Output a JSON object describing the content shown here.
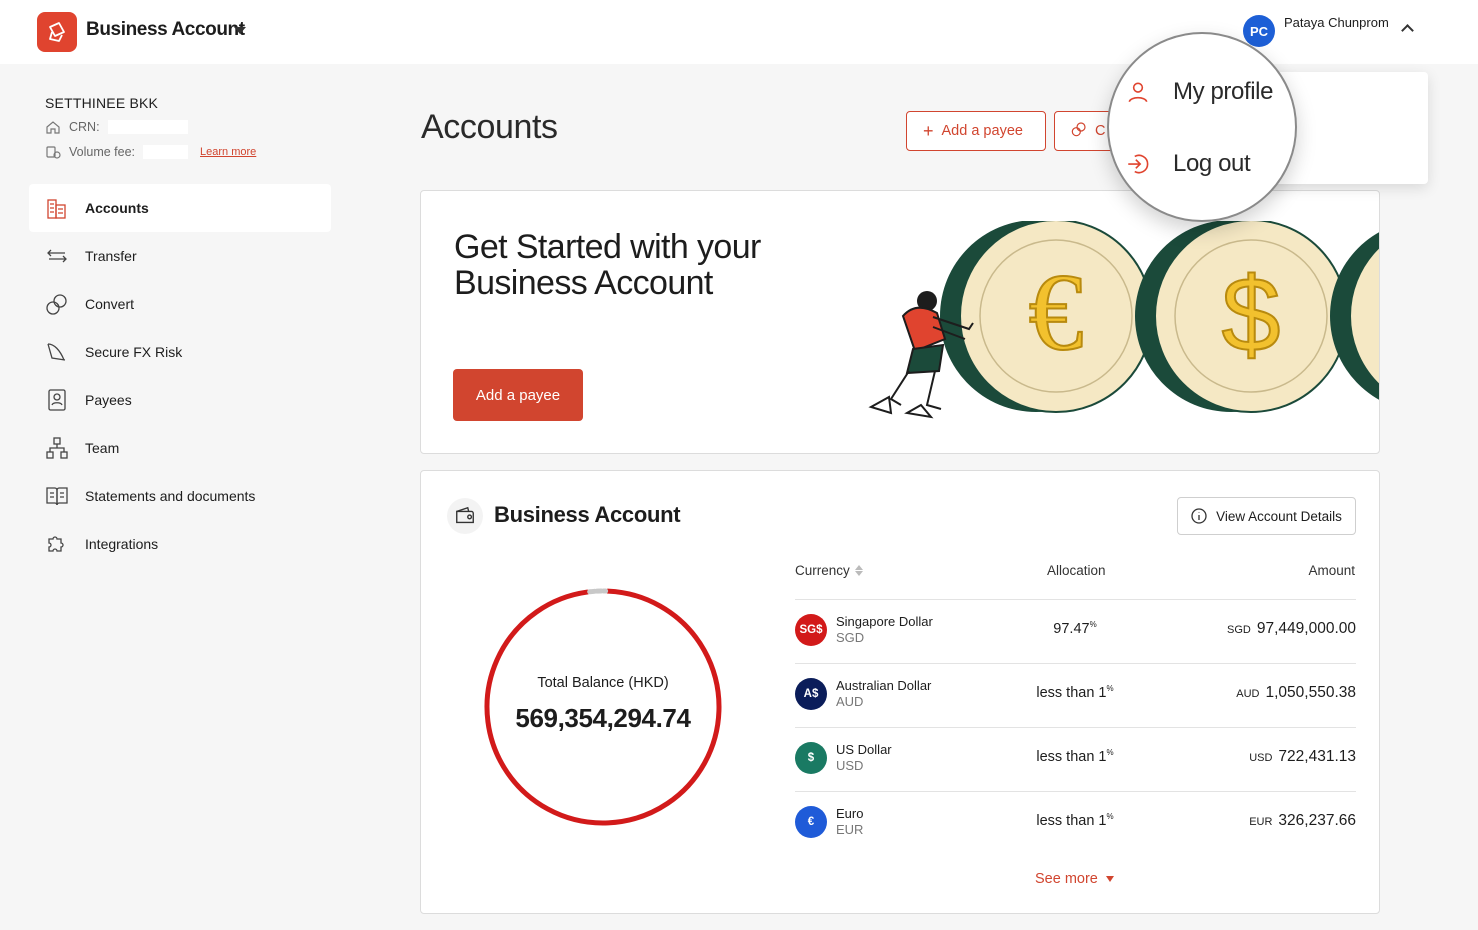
{
  "header": {
    "brand": "Business Account",
    "user_initials": "PC",
    "user_name": "Pataya Chunprom"
  },
  "sidebar": {
    "org_name": "SETTHINEE BKK",
    "crn_label": "CRN:",
    "volume_fee_label": "Volume fee:",
    "learn_more": "Learn more",
    "items": [
      {
        "label": "Accounts",
        "icon": "building-icon",
        "active": true
      },
      {
        "label": "Transfer",
        "icon": "transfer-arrows-icon"
      },
      {
        "label": "Convert",
        "icon": "convert-currency-icon"
      },
      {
        "label": "Secure FX Risk",
        "icon": "shield-fx-icon"
      },
      {
        "label": "Payees",
        "icon": "payee-contact-icon"
      },
      {
        "label": "Team",
        "icon": "team-hierarchy-icon"
      },
      {
        "label": "Statements and documents",
        "icon": "document-book-icon"
      },
      {
        "label": "Integrations",
        "icon": "puzzle-icon"
      }
    ]
  },
  "main": {
    "title": "Accounts",
    "add_payee_button": "Add a payee",
    "convert_button_partial": "C",
    "promo": {
      "title": "Get Started with your Business Account",
      "button": "Add a payee"
    },
    "business_account": {
      "title": "Business Account",
      "view_details_button": "View Account Details",
      "total_balance_label": "Total Balance (HKD)",
      "total_balance_value": "569,354,294.74",
      "columns": {
        "currency": "Currency",
        "allocation": "Allocation",
        "amount": "Amount"
      },
      "rows": [
        {
          "badge": "SG$",
          "badge_color": "#d21a1a",
          "name": "Singapore Dollar",
          "code": "SGD",
          "allocation": "97.47",
          "allocation_suffix": "%",
          "amount_code": "SGD",
          "amount": "97,449,000.00"
        },
        {
          "badge": "A$",
          "badge_color": "#0b1d5a",
          "name": "Australian Dollar",
          "code": "AUD",
          "allocation": "less than 1",
          "allocation_suffix": "%",
          "amount_code": "AUD",
          "amount": "1,050,550.38"
        },
        {
          "badge": "$",
          "badge_color": "#1a7a63",
          "name": "US Dollar",
          "code": "USD",
          "allocation": "less than 1",
          "allocation_suffix": "%",
          "amount_code": "USD",
          "amount": "722,431.13"
        },
        {
          "badge": "€",
          "badge_color": "#1f5bd8",
          "name": "Euro",
          "code": "EUR",
          "allocation": "less than 1",
          "allocation_suffix": "%",
          "amount_code": "EUR",
          "amount": "326,237.66"
        }
      ],
      "see_more": "See more"
    }
  },
  "user_menu": {
    "items": [
      {
        "label": "My profile",
        "icon": "user-icon"
      },
      {
        "label": "Log out",
        "icon": "logout-icon"
      }
    ]
  },
  "colors": {
    "brand_red": "#d1452f",
    "donut_red": "#d21a1a",
    "coin_green": "#1b4a3a",
    "coin_gold": "#f2c12e"
  },
  "chart_data": {
    "type": "pie",
    "title": "Total Balance (HKD)",
    "categories": [
      "SGD",
      "AUD",
      "USD",
      "EUR"
    ],
    "values": [
      97.47,
      1.0,
      0.9,
      0.63
    ]
  }
}
